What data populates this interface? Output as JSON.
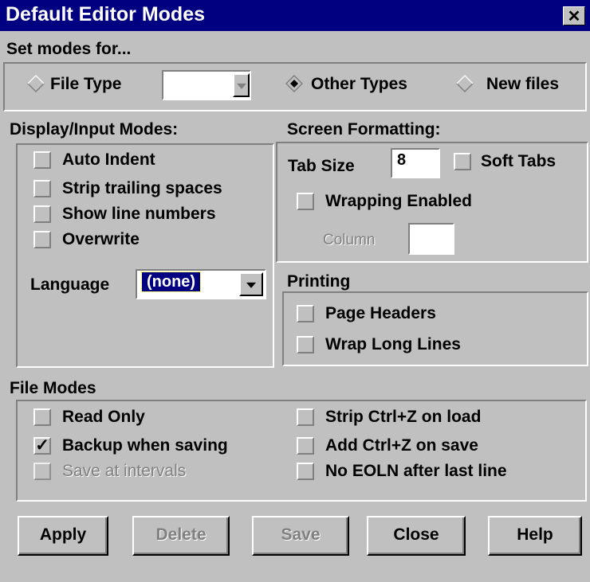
{
  "window": {
    "title": "Default Editor Modes",
    "close_label": "✕"
  },
  "set_modes": {
    "label": "Set modes for...",
    "file_type_label": "File Type",
    "file_type_value": "",
    "other_types_label": "Other Types",
    "new_files_label": "New files",
    "selected": "other_types"
  },
  "display_input": {
    "label": "Display/Input Modes:",
    "auto_indent": "Auto Indent",
    "strip_trailing": "Strip trailing spaces",
    "show_line_numbers": "Show line numbers",
    "overwrite": "Overwrite",
    "language_label": "Language",
    "language_value": "(none)"
  },
  "screen_formatting": {
    "label": "Screen Formatting:",
    "tab_size_label": "Tab Size",
    "tab_size_value": "8",
    "soft_tabs": "Soft Tabs",
    "wrapping_enabled": "Wrapping Enabled",
    "column_label": "Column",
    "column_value": ""
  },
  "printing": {
    "label": "Printing",
    "page_headers": "Page Headers",
    "wrap_long_lines": "Wrap Long Lines"
  },
  "file_modes": {
    "label": "File Modes",
    "read_only": "Read Only",
    "backup_when_saving": "Backup when saving",
    "backup_checked_mark": "✓",
    "save_at_intervals": "Save at intervals",
    "strip_ctrlz_on_load": "Strip Ctrl+Z on load",
    "add_ctrlz_on_save": "Add Ctrl+Z on save",
    "no_eoln": "No EOLN after last line"
  },
  "buttons": {
    "apply": "Apply",
    "delete": "Delete",
    "save": "Save",
    "close": "Close",
    "help": "Help"
  }
}
